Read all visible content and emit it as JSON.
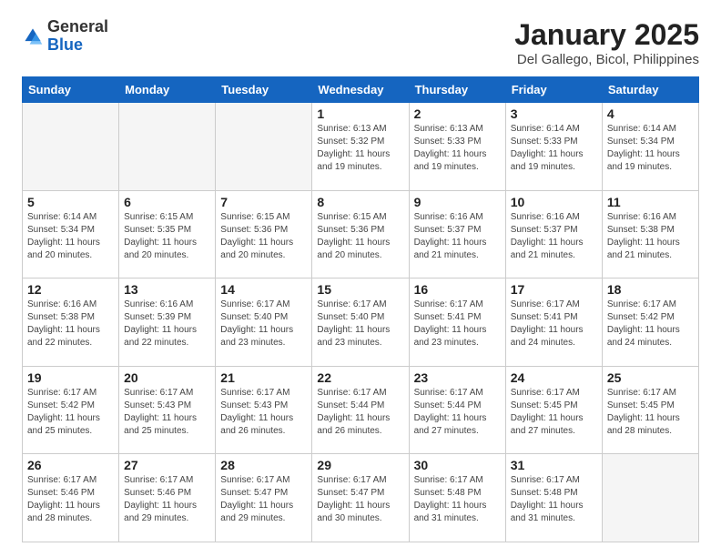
{
  "logo": {
    "general": "General",
    "blue": "Blue"
  },
  "header": {
    "month": "January 2025",
    "location": "Del Gallego, Bicol, Philippines"
  },
  "weekdays": [
    "Sunday",
    "Monday",
    "Tuesday",
    "Wednesday",
    "Thursday",
    "Friday",
    "Saturday"
  ],
  "weeks": [
    [
      {
        "day": "",
        "info": ""
      },
      {
        "day": "",
        "info": ""
      },
      {
        "day": "",
        "info": ""
      },
      {
        "day": "1",
        "info": "Sunrise: 6:13 AM\nSunset: 5:32 PM\nDaylight: 11 hours\nand 19 minutes."
      },
      {
        "day": "2",
        "info": "Sunrise: 6:13 AM\nSunset: 5:33 PM\nDaylight: 11 hours\nand 19 minutes."
      },
      {
        "day": "3",
        "info": "Sunrise: 6:14 AM\nSunset: 5:33 PM\nDaylight: 11 hours\nand 19 minutes."
      },
      {
        "day": "4",
        "info": "Sunrise: 6:14 AM\nSunset: 5:34 PM\nDaylight: 11 hours\nand 19 minutes."
      }
    ],
    [
      {
        "day": "5",
        "info": "Sunrise: 6:14 AM\nSunset: 5:34 PM\nDaylight: 11 hours\nand 20 minutes."
      },
      {
        "day": "6",
        "info": "Sunrise: 6:15 AM\nSunset: 5:35 PM\nDaylight: 11 hours\nand 20 minutes."
      },
      {
        "day": "7",
        "info": "Sunrise: 6:15 AM\nSunset: 5:36 PM\nDaylight: 11 hours\nand 20 minutes."
      },
      {
        "day": "8",
        "info": "Sunrise: 6:15 AM\nSunset: 5:36 PM\nDaylight: 11 hours\nand 20 minutes."
      },
      {
        "day": "9",
        "info": "Sunrise: 6:16 AM\nSunset: 5:37 PM\nDaylight: 11 hours\nand 21 minutes."
      },
      {
        "day": "10",
        "info": "Sunrise: 6:16 AM\nSunset: 5:37 PM\nDaylight: 11 hours\nand 21 minutes."
      },
      {
        "day": "11",
        "info": "Sunrise: 6:16 AM\nSunset: 5:38 PM\nDaylight: 11 hours\nand 21 minutes."
      }
    ],
    [
      {
        "day": "12",
        "info": "Sunrise: 6:16 AM\nSunset: 5:38 PM\nDaylight: 11 hours\nand 22 minutes."
      },
      {
        "day": "13",
        "info": "Sunrise: 6:16 AM\nSunset: 5:39 PM\nDaylight: 11 hours\nand 22 minutes."
      },
      {
        "day": "14",
        "info": "Sunrise: 6:17 AM\nSunset: 5:40 PM\nDaylight: 11 hours\nand 23 minutes."
      },
      {
        "day": "15",
        "info": "Sunrise: 6:17 AM\nSunset: 5:40 PM\nDaylight: 11 hours\nand 23 minutes."
      },
      {
        "day": "16",
        "info": "Sunrise: 6:17 AM\nSunset: 5:41 PM\nDaylight: 11 hours\nand 23 minutes."
      },
      {
        "day": "17",
        "info": "Sunrise: 6:17 AM\nSunset: 5:41 PM\nDaylight: 11 hours\nand 24 minutes."
      },
      {
        "day": "18",
        "info": "Sunrise: 6:17 AM\nSunset: 5:42 PM\nDaylight: 11 hours\nand 24 minutes."
      }
    ],
    [
      {
        "day": "19",
        "info": "Sunrise: 6:17 AM\nSunset: 5:42 PM\nDaylight: 11 hours\nand 25 minutes."
      },
      {
        "day": "20",
        "info": "Sunrise: 6:17 AM\nSunset: 5:43 PM\nDaylight: 11 hours\nand 25 minutes."
      },
      {
        "day": "21",
        "info": "Sunrise: 6:17 AM\nSunset: 5:43 PM\nDaylight: 11 hours\nand 26 minutes."
      },
      {
        "day": "22",
        "info": "Sunrise: 6:17 AM\nSunset: 5:44 PM\nDaylight: 11 hours\nand 26 minutes."
      },
      {
        "day": "23",
        "info": "Sunrise: 6:17 AM\nSunset: 5:44 PM\nDaylight: 11 hours\nand 27 minutes."
      },
      {
        "day": "24",
        "info": "Sunrise: 6:17 AM\nSunset: 5:45 PM\nDaylight: 11 hours\nand 27 minutes."
      },
      {
        "day": "25",
        "info": "Sunrise: 6:17 AM\nSunset: 5:45 PM\nDaylight: 11 hours\nand 28 minutes."
      }
    ],
    [
      {
        "day": "26",
        "info": "Sunrise: 6:17 AM\nSunset: 5:46 PM\nDaylight: 11 hours\nand 28 minutes."
      },
      {
        "day": "27",
        "info": "Sunrise: 6:17 AM\nSunset: 5:46 PM\nDaylight: 11 hours\nand 29 minutes."
      },
      {
        "day": "28",
        "info": "Sunrise: 6:17 AM\nSunset: 5:47 PM\nDaylight: 11 hours\nand 29 minutes."
      },
      {
        "day": "29",
        "info": "Sunrise: 6:17 AM\nSunset: 5:47 PM\nDaylight: 11 hours\nand 30 minutes."
      },
      {
        "day": "30",
        "info": "Sunrise: 6:17 AM\nSunset: 5:48 PM\nDaylight: 11 hours\nand 31 minutes."
      },
      {
        "day": "31",
        "info": "Sunrise: 6:17 AM\nSunset: 5:48 PM\nDaylight: 11 hours\nand 31 minutes."
      },
      {
        "day": "",
        "info": ""
      }
    ]
  ]
}
